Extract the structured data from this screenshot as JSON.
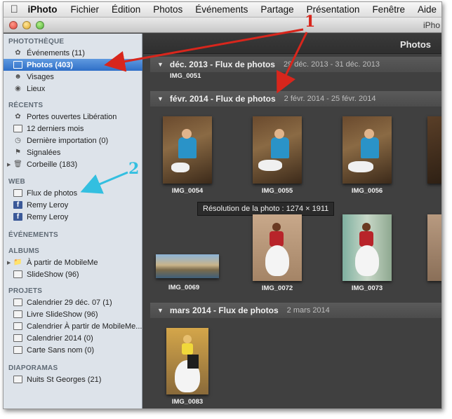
{
  "menubar": {
    "app": "iPhoto",
    "items": [
      "Fichier",
      "Édition",
      "Photos",
      "Événements",
      "Partage",
      "Présentation",
      "Fenêtre",
      "Aide"
    ]
  },
  "window": {
    "title": "iPho"
  },
  "sidebar": {
    "sections": [
      {
        "title": "PHOTOTHÈQUE",
        "items": [
          {
            "label": "Événements (11)",
            "icon": "events-icon"
          },
          {
            "label": "Photos (403)",
            "icon": "photos-icon",
            "selected": true
          },
          {
            "label": "Visages",
            "icon": "faces-icon"
          },
          {
            "label": "Lieux",
            "icon": "places-icon"
          }
        ]
      },
      {
        "title": "RÉCENTS",
        "items": [
          {
            "label": "Portes ouvertes Libération",
            "icon": "event-icon"
          },
          {
            "label": "12 derniers mois",
            "icon": "calendar-icon"
          },
          {
            "label": "Dernière importation (0)",
            "icon": "import-icon"
          },
          {
            "label": "Signalées",
            "icon": "flag-icon"
          },
          {
            "label": "Corbeille (183)",
            "icon": "trash-icon"
          }
        ]
      },
      {
        "title": "WEB",
        "items": [
          {
            "label": "Flux de photos",
            "icon": "photostream-icon"
          },
          {
            "label": "Remy Leroy",
            "icon": "facebook-icon"
          },
          {
            "label": "Remy Leroy",
            "icon": "facebook-icon"
          }
        ]
      },
      {
        "title": "ÉVÉNEMENTS",
        "items": []
      },
      {
        "title": "ALBUMS",
        "items": [
          {
            "label": "À partir de MobileMe",
            "icon": "folder-icon"
          },
          {
            "label": "SlideShow (96)",
            "icon": "album-icon"
          }
        ]
      },
      {
        "title": "PROJETS",
        "items": [
          {
            "label": "Calendrier 29 déc. 07 (1)",
            "icon": "calendar-project-icon"
          },
          {
            "label": "Livre SlideShow (96)",
            "icon": "book-icon"
          },
          {
            "label": "Calendrier À partir de MobileMe...",
            "icon": "calendar-project-icon"
          },
          {
            "label": "Calendrier 2014 (0)",
            "icon": "calendar-project-icon"
          },
          {
            "label": "Carte Sans nom (0)",
            "icon": "card-icon"
          }
        ]
      },
      {
        "title": "DIAPORAMAS",
        "items": [
          {
            "label": "Nuits St Georges (21)",
            "icon": "slideshow-icon"
          }
        ]
      }
    ]
  },
  "main": {
    "title": "Photos",
    "sections": [
      {
        "name": "déc. 2013 - Flux de photos",
        "dates": "29 déc. 2013 - 31 déc. 2013"
      },
      {
        "name": "févr. 2014 - Flux de photos",
        "dates": "2 févr. 2014 - 25 févr. 2014"
      },
      {
        "name": "mars 2014 - Flux de photos",
        "dates": "2 mars 2014"
      }
    ],
    "captions": {
      "img0051": "IMG_0051",
      "img0054": "IMG_0054",
      "img0055": "IMG_0055",
      "img0056": "IMG_0056",
      "img0069": "IMG_0069",
      "img0072": "IMG_0072",
      "img0073": "IMG_0073",
      "img0083": "IMG_0083"
    },
    "tooltip": "Résolution de la photo : 1274 × 1911"
  },
  "annotations": {
    "label1": "1",
    "label2": "2",
    "color1": "#d8261c",
    "color2": "#33bfe0"
  }
}
